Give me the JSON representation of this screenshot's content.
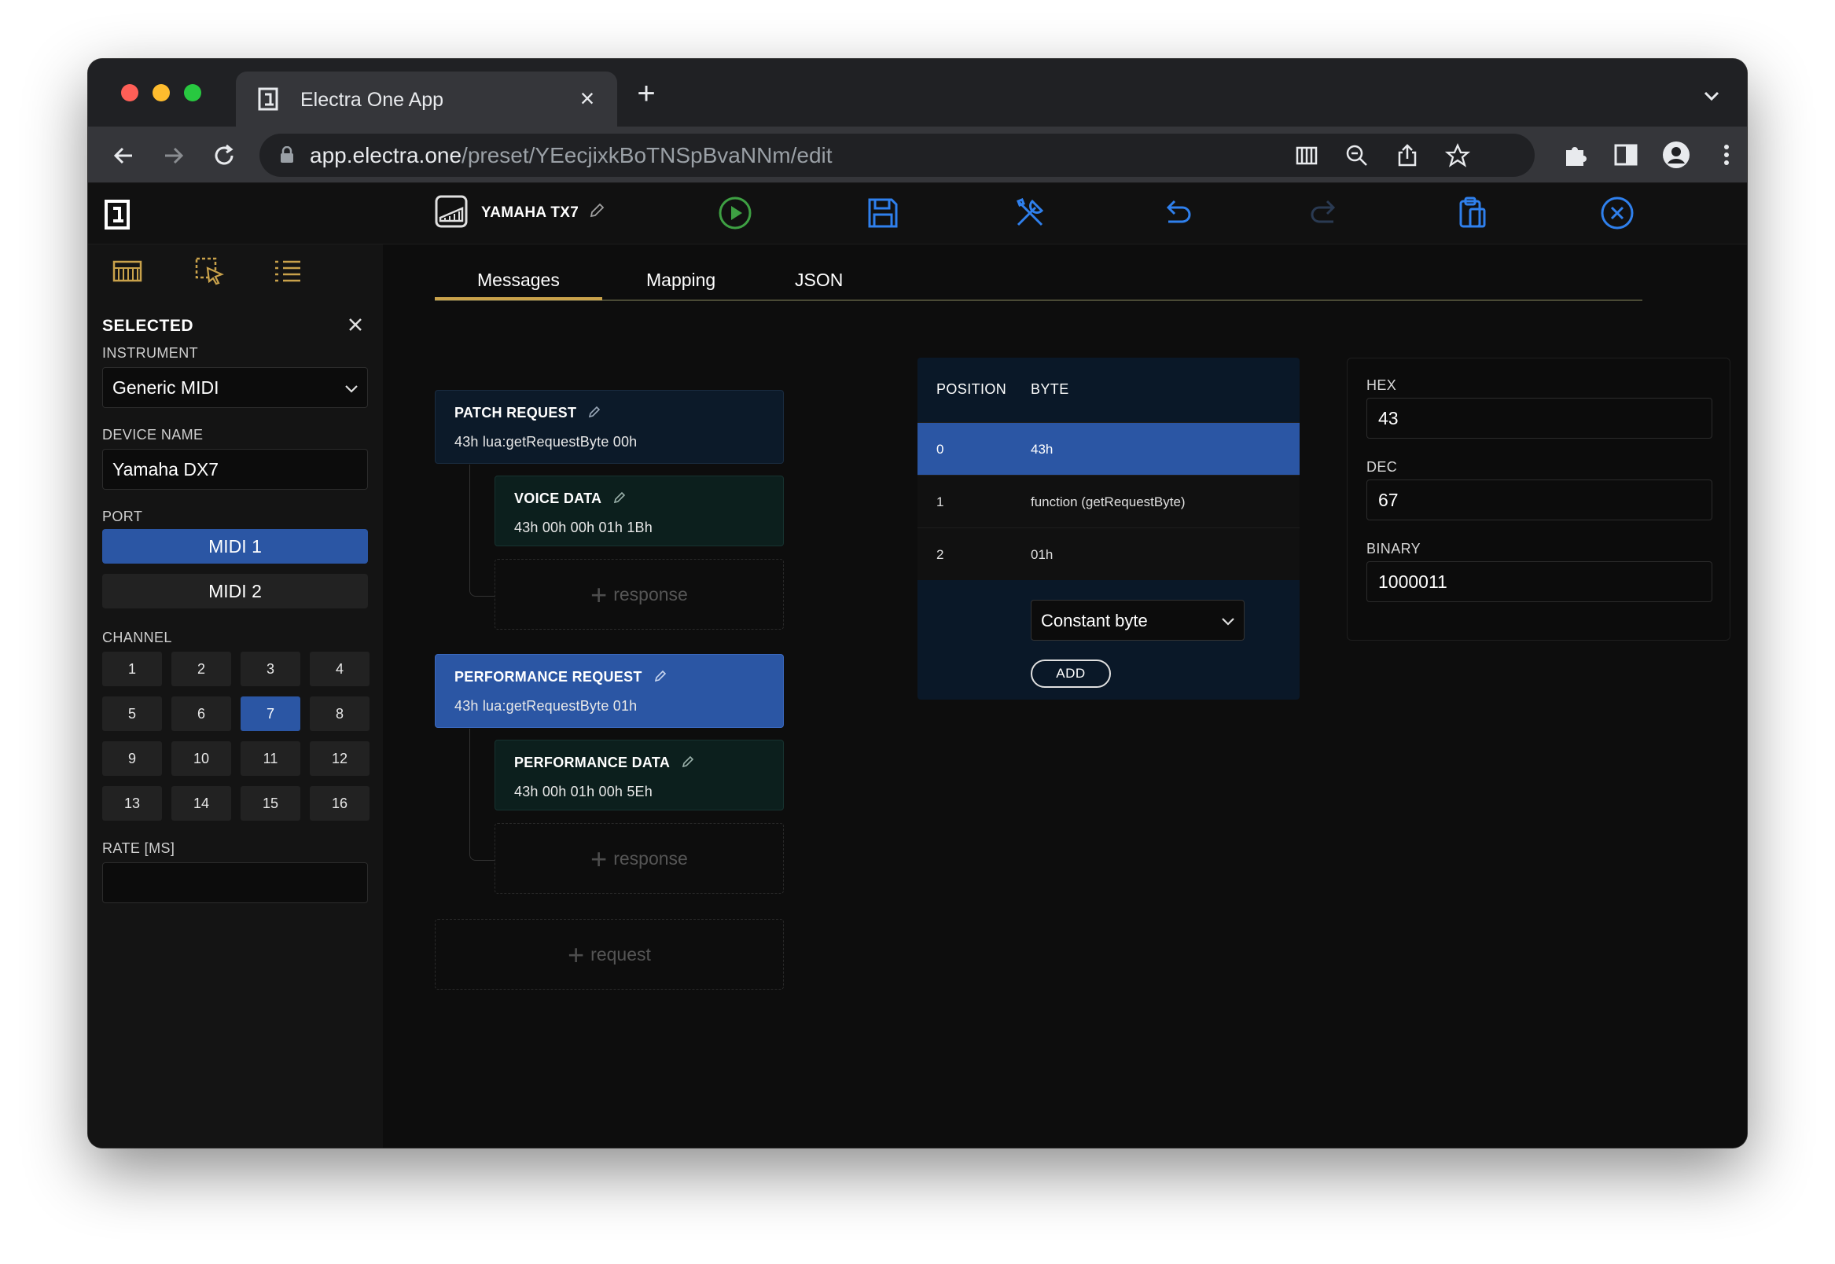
{
  "browser": {
    "tab_title": "Electra One App",
    "url_host": "app.electra.one",
    "url_path": "/preset/YEecjixkBoTNSpBvaNNm/edit"
  },
  "app": {
    "preset_name": "YAMAHA TX7",
    "colors": {
      "accent_blue": "#2b56a4",
      "gold": "#c9a24b",
      "play_green": "#3ea043",
      "action_blue": "#2f80ed"
    }
  },
  "sidebar": {
    "selected_label": "SELECTED",
    "instrument_label": "INSTRUMENT",
    "instrument_value": "Generic MIDI",
    "device_name_label": "DEVICE NAME",
    "device_name_value": "Yamaha DX7",
    "port_label": "PORT",
    "ports": [
      "MIDI 1",
      "MIDI 2"
    ],
    "selected_port": "MIDI 1",
    "channel_label": "CHANNEL",
    "channels": [
      "1",
      "2",
      "3",
      "4",
      "5",
      "6",
      "7",
      "8",
      "9",
      "10",
      "11",
      "12",
      "13",
      "14",
      "15",
      "16"
    ],
    "selected_channel": "7",
    "rate_label": "RATE [MS]",
    "rate_value": ""
  },
  "main": {
    "tabs": [
      "Messages",
      "Mapping",
      "JSON"
    ],
    "active_tab": "Messages",
    "requests": [
      {
        "title": "PATCH REQUEST",
        "bytes": "43h lua:getRequestByte 00h",
        "response": {
          "title": "VOICE DATA",
          "bytes": "43h 00h 00h 01h 1Bh"
        }
      },
      {
        "title": "PERFORMANCE REQUEST",
        "bytes": "43h lua:getRequestByte 01h",
        "response": {
          "title": "PERFORMANCE DATA",
          "bytes": "43h 00h 01h 00h 5Eh"
        }
      }
    ],
    "add_response_label": "response",
    "add_request_label": "request",
    "byte_table": {
      "col_position": "POSITION",
      "col_byte": "BYTE",
      "rows": [
        {
          "position": "0",
          "byte": "43h"
        },
        {
          "position": "1",
          "byte": "function (getRequestByte)"
        },
        {
          "position": "2",
          "byte": "01h"
        }
      ],
      "selected_row": 0,
      "type_select_value": "Constant byte",
      "add_button": "ADD"
    },
    "converter": {
      "hex_label": "HEX",
      "hex_value": "43",
      "dec_label": "DEC",
      "dec_value": "67",
      "binary_label": "BINARY",
      "binary_value": "1000011"
    }
  }
}
